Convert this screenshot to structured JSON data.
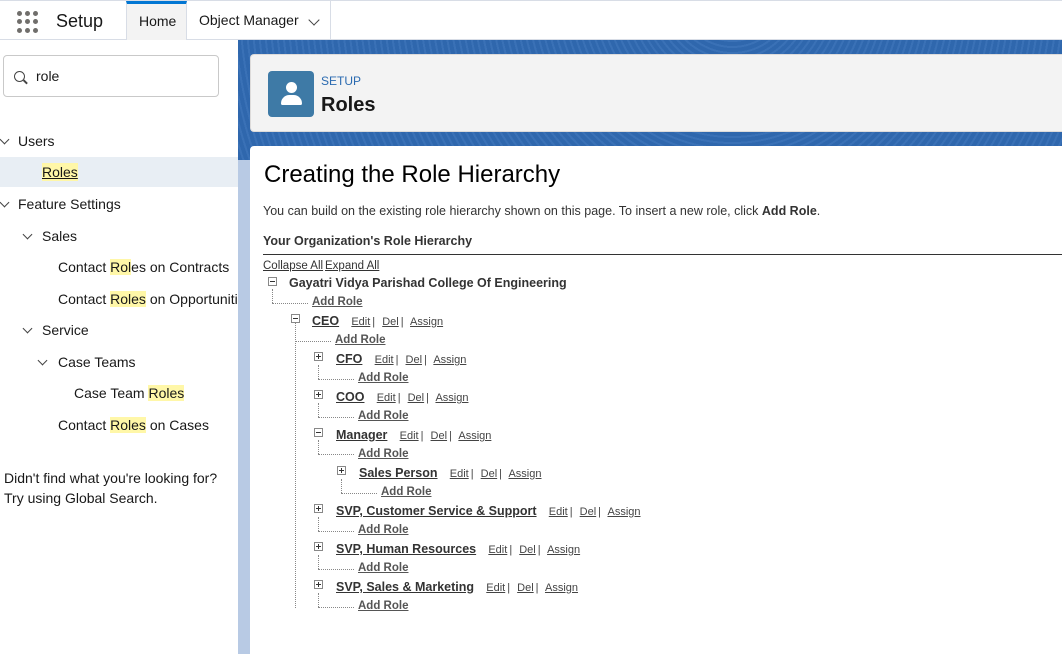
{
  "topbar": {
    "app_name": "Setup",
    "tabs": [
      {
        "label": "Home"
      },
      {
        "label": "Object Manager"
      }
    ]
  },
  "sidebar": {
    "search_value": "role",
    "items": [
      {
        "label": "Users"
      },
      {
        "label": "Roles"
      },
      {
        "label": "Feature Settings"
      },
      {
        "label": "Sales"
      },
      {
        "label_pre": "Contact ",
        "label_hl": "Rol",
        "label_post": "es on Contracts"
      },
      {
        "label_pre": "Contact ",
        "label_hl": "Roles",
        "label_post": " on Opportunities"
      },
      {
        "label": "Service"
      },
      {
        "label": "Case Teams"
      },
      {
        "label_pre": "Case Team ",
        "label_hl": "Roles",
        "label_post": ""
      },
      {
        "label_pre": "Contact ",
        "label_hl": "Roles",
        "label_post": " on Cases"
      }
    ],
    "not_found_1": "Didn't find what you're looking for?",
    "not_found_2": "Try using Global Search."
  },
  "header": {
    "eyebrow": "SETUP",
    "title": "Roles"
  },
  "main": {
    "heading": "Creating the Role Hierarchy",
    "intro_text": "You can build on the existing role hierarchy shown on this page. To insert a new role, click ",
    "intro_bold": "Add Role",
    "intro_end": ".",
    "section_title": "Your Organization's Role Hierarchy",
    "collapse_all": "Collapse All",
    "expand_all": "Expand All",
    "root": "Gayatri Vidya Parishad College Of Engineering",
    "add_role": "Add Role",
    "actions": {
      "edit": "Edit",
      "del": "Del",
      "assign": "Assign"
    },
    "roles": [
      {
        "name": "CEO"
      },
      {
        "name": "CFO"
      },
      {
        "name": "COO"
      },
      {
        "name": "Manager"
      },
      {
        "name": "Sales Person"
      },
      {
        "name": "SVP, Customer Service & Support"
      },
      {
        "name": "SVP, Human Resources"
      },
      {
        "name": "SVP, Sales & Marketing"
      }
    ]
  }
}
